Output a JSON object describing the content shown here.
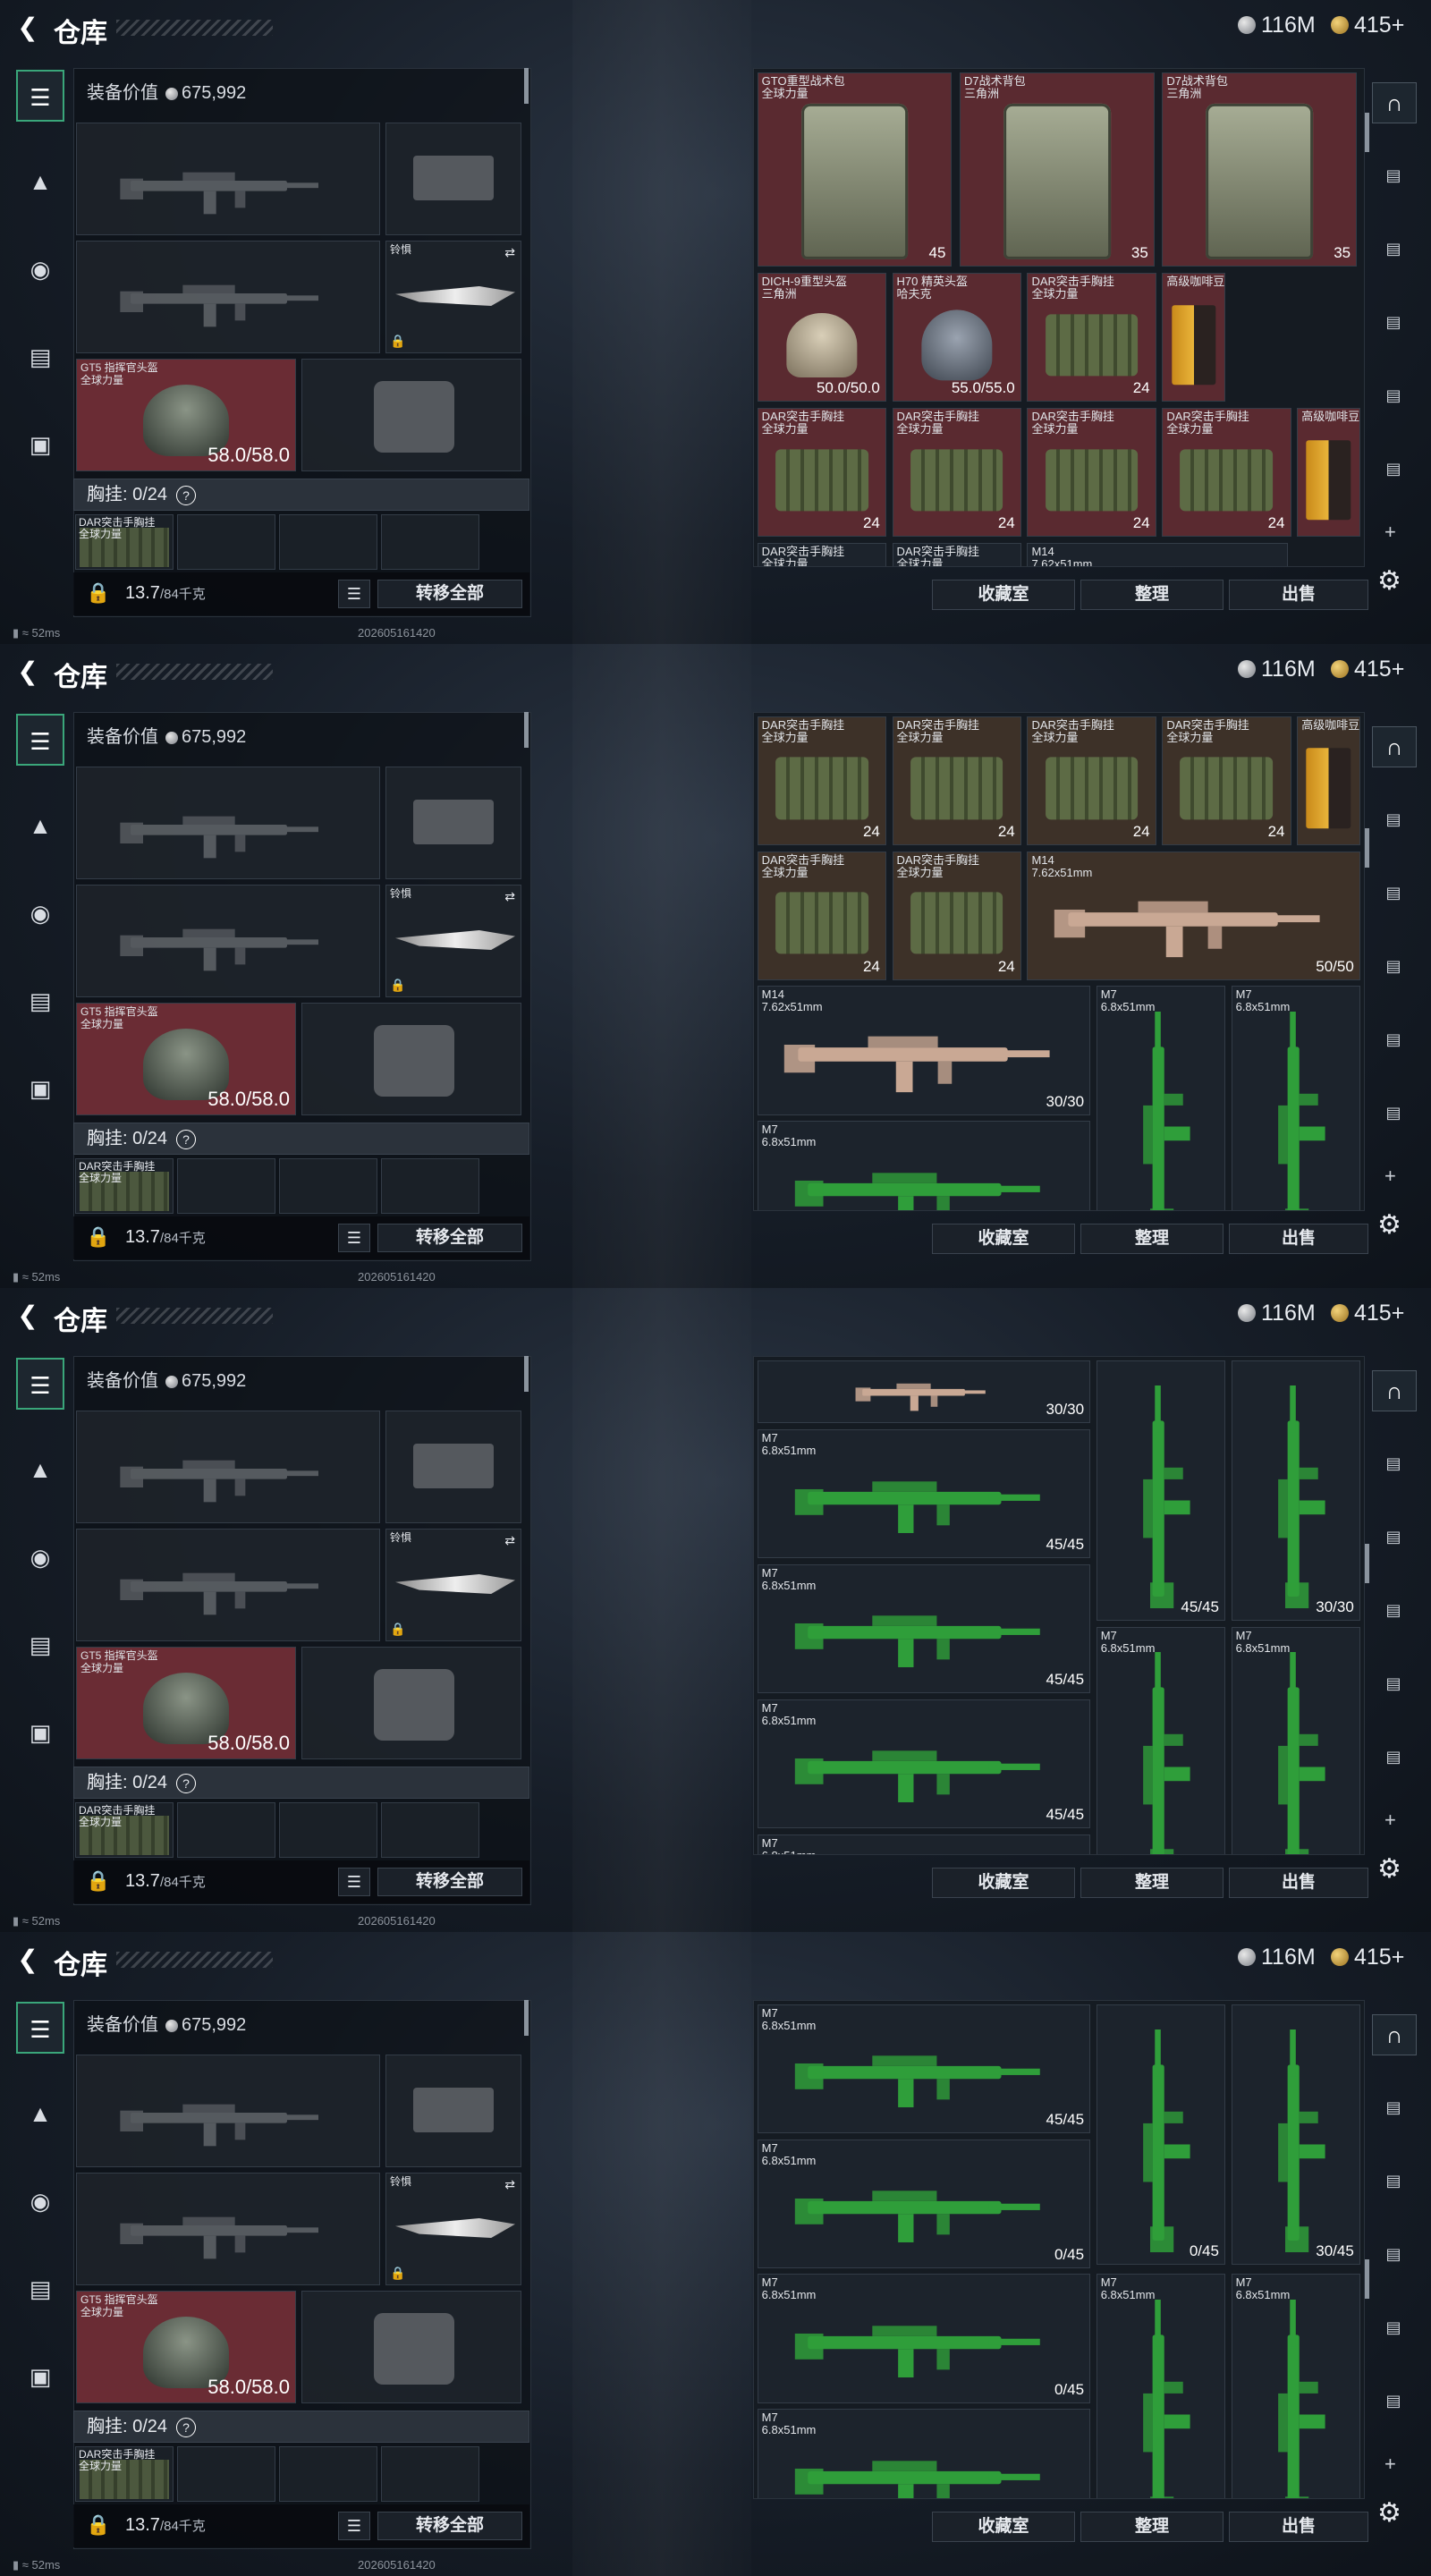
{
  "app": {
    "title": "仓库",
    "currency": [
      {
        "icon": "silver-coin-icon",
        "value": "116M"
      },
      {
        "icon": "gold-coin-icon",
        "value": "415+"
      }
    ],
    "status_ping": "52ms",
    "status_build": "202605161420"
  },
  "left": {
    "equipment_value_label": "装备价值",
    "equipment_value": "675,992",
    "melee_label": "铃惧",
    "helmet_name": "GT5 指挥官头盔",
    "helmet_sub": "全球力量",
    "helmet_durability": "58.0/58.0",
    "chest_label": "胸挂: 0/24",
    "chest_help": "?",
    "chest_item_name": "DAR突击手胸挂",
    "chest_item_sub": "全球力量",
    "weight": "13.7",
    "weight_cap": "/84千克",
    "move_all": "转移全部"
  },
  "right": {
    "buttons": {
      "collection": "收藏室",
      "sort": "整理",
      "sell": "出售"
    }
  },
  "frames": [
    {
      "items": [
        {
          "name": "GTO重型战术包",
          "sub": "全球力量",
          "val": "45",
          "tint": "red"
        },
        {
          "name": "D7战术背包",
          "sub": "三角洲",
          "val": "35",
          "tint": "red"
        },
        {
          "name": "D7战术背包",
          "sub": "三角洲",
          "val": "35",
          "tint": "red"
        },
        {
          "name": "DICH-9重型头盔",
          "sub": "三角洲",
          "val": "50.0/50.0",
          "tint": "red"
        },
        {
          "name": "H70 精英头盔",
          "sub": "哈夫克",
          "val": "55.0/55.0",
          "tint": "red"
        },
        {
          "name": "DAR突击手胸挂",
          "sub": "全球力量",
          "val": "24",
          "tint": "red"
        },
        {
          "name": "高级咖啡豆",
          "sub": "",
          "val": "",
          "tint": "red"
        },
        {
          "name": "DAR突击手胸挂",
          "sub": "全球力量",
          "val": "24",
          "tint": "red"
        },
        {
          "name": "DAR突击手胸挂",
          "sub": "全球力量",
          "val": "24",
          "tint": "red"
        },
        {
          "name": "DAR突击手胸挂",
          "sub": "全球力量",
          "val": "24",
          "tint": "red"
        },
        {
          "name": "DAR突击手胸挂",
          "sub": "全球力量",
          "val": "24",
          "tint": "red"
        },
        {
          "name": "高级咖啡豆",
          "sub": "",
          "val": "",
          "tint": "red"
        },
        {
          "name": "DAR突击手胸挂",
          "sub": "全球力量",
          "val": "",
          "tint": ""
        },
        {
          "name": "DAR突击手胸挂",
          "sub": "全球力量",
          "val": "",
          "tint": ""
        },
        {
          "name": "M14",
          "sub": "7.62x51mm",
          "val": "",
          "tint": ""
        }
      ]
    },
    {
      "items": [
        {
          "name": "DAR突击手胸挂",
          "sub": "全球力量",
          "val": "24",
          "tint": "brown"
        },
        {
          "name": "DAR突击手胸挂",
          "sub": "全球力量",
          "val": "24",
          "tint": "brown"
        },
        {
          "name": "DAR突击手胸挂",
          "sub": "全球力量",
          "val": "24",
          "tint": "brown"
        },
        {
          "name": "DAR突击手胸挂",
          "sub": "全球力量",
          "val": "24",
          "tint": "brown"
        },
        {
          "name": "高级咖啡豆",
          "sub": "",
          "val": "",
          "tint": "brown"
        },
        {
          "name": "DAR突击手胸挂",
          "sub": "全球力量",
          "val": "24",
          "tint": "brown"
        },
        {
          "name": "DAR突击手胸挂",
          "sub": "全球力量",
          "val": "24",
          "tint": "brown"
        },
        {
          "name": "M14",
          "sub": "7.62x51mm",
          "val": "50/50",
          "tint": "brown"
        },
        {
          "name": "M14",
          "sub": "7.62x51mm",
          "val": "30/30",
          "tint": ""
        },
        {
          "name": "M7",
          "sub": "6.8x51mm",
          "val": "",
          "tint": ""
        },
        {
          "name": "M7",
          "sub": "6.8x51mm",
          "val": "",
          "tint": ""
        },
        {
          "name": "M7",
          "sub": "6.8x51mm",
          "val": "",
          "tint": ""
        }
      ]
    },
    {
      "items": [
        {
          "name": "",
          "sub": "",
          "val": "30/30",
          "tint": ""
        },
        {
          "name": "M7",
          "sub": "6.8x51mm",
          "val": "45/45",
          "tint": ""
        },
        {
          "name": "",
          "sub": "",
          "val": "45/45",
          "tint": ""
        },
        {
          "name": "",
          "sub": "",
          "val": "30/30",
          "tint": ""
        },
        {
          "name": "M7",
          "sub": "6.8x51mm",
          "val": "45/45",
          "tint": ""
        },
        {
          "name": "M7",
          "sub": "6.8x51mm",
          "val": "",
          "tint": ""
        },
        {
          "name": "M7",
          "sub": "6.8x51mm",
          "val": "",
          "tint": ""
        },
        {
          "name": "M7",
          "sub": "6.8x51mm",
          "val": "45/45",
          "tint": ""
        },
        {
          "name": "M7",
          "sub": "6.8x51mm",
          "val": "",
          "tint": ""
        }
      ]
    },
    {
      "items": [
        {
          "name": "M7",
          "sub": "6.8x51mm",
          "val": "45/45",
          "tint": ""
        },
        {
          "name": "",
          "sub": "",
          "val": "0/45",
          "tint": ""
        },
        {
          "name": "",
          "sub": "",
          "val": "30/45",
          "tint": ""
        },
        {
          "name": "M7",
          "sub": "6.8x51mm",
          "val": "0/45",
          "tint": ""
        },
        {
          "name": "M7",
          "sub": "6.8x51mm",
          "val": "0/45",
          "tint": ""
        },
        {
          "name": "M7",
          "sub": "6.8x51mm",
          "val": "",
          "tint": ""
        },
        {
          "name": "M7",
          "sub": "6.8x51mm",
          "val": "",
          "tint": ""
        },
        {
          "name": "M7",
          "sub": "6.8x51mm",
          "val": "",
          "tint": ""
        }
      ]
    }
  ]
}
